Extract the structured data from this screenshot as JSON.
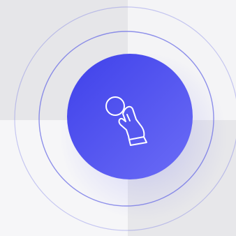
{
  "colors": {
    "accent_light": "#6b6cf6",
    "accent_dark": "#3f41ea",
    "ring": "#6b6de6",
    "icon_stroke": "#ffffff"
  },
  "icon": {
    "name": "hand-pointer-icon"
  }
}
